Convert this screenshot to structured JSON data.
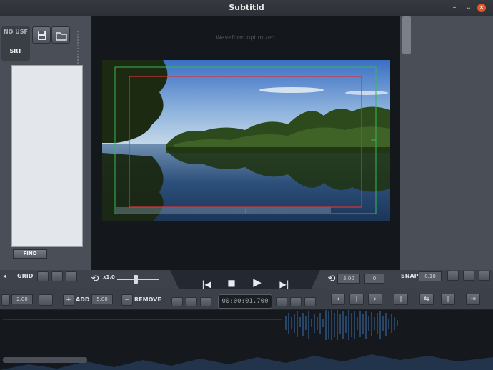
{
  "window": {
    "title": "Subtitld",
    "controls": [
      "–",
      "⌄",
      "×"
    ]
  },
  "left_panel": {
    "formats": [
      "NO USF",
      "SRT"
    ],
    "save_icon": "floppy-disk-icon",
    "open_icon": "folder-icon",
    "find_label": "FIND"
  },
  "player": {
    "overlay_text": "Waveform optimized",
    "safe_area_colors": {
      "title_safe": "#e0313a",
      "action_safe": "#35b856"
    }
  },
  "transport": {
    "grid_label": "GRID",
    "speed_value": "x1.0",
    "slider_level_fraction": 0.45,
    "left_box_1": "5.00",
    "left_box_2": "0",
    "snap_label": "SNAP",
    "snap_value": "0.10"
  },
  "editbar": {
    "step_value": "2.00",
    "add_label": "ADD",
    "add_value": "5.00",
    "remove_label": "REMOVE",
    "timecode": "00:00:01.700"
  },
  "colors": {
    "accent_red": "#c8202a",
    "waveform": "#2d4f7a",
    "panel": "#4a4f57",
    "dark": "#14171b"
  }
}
